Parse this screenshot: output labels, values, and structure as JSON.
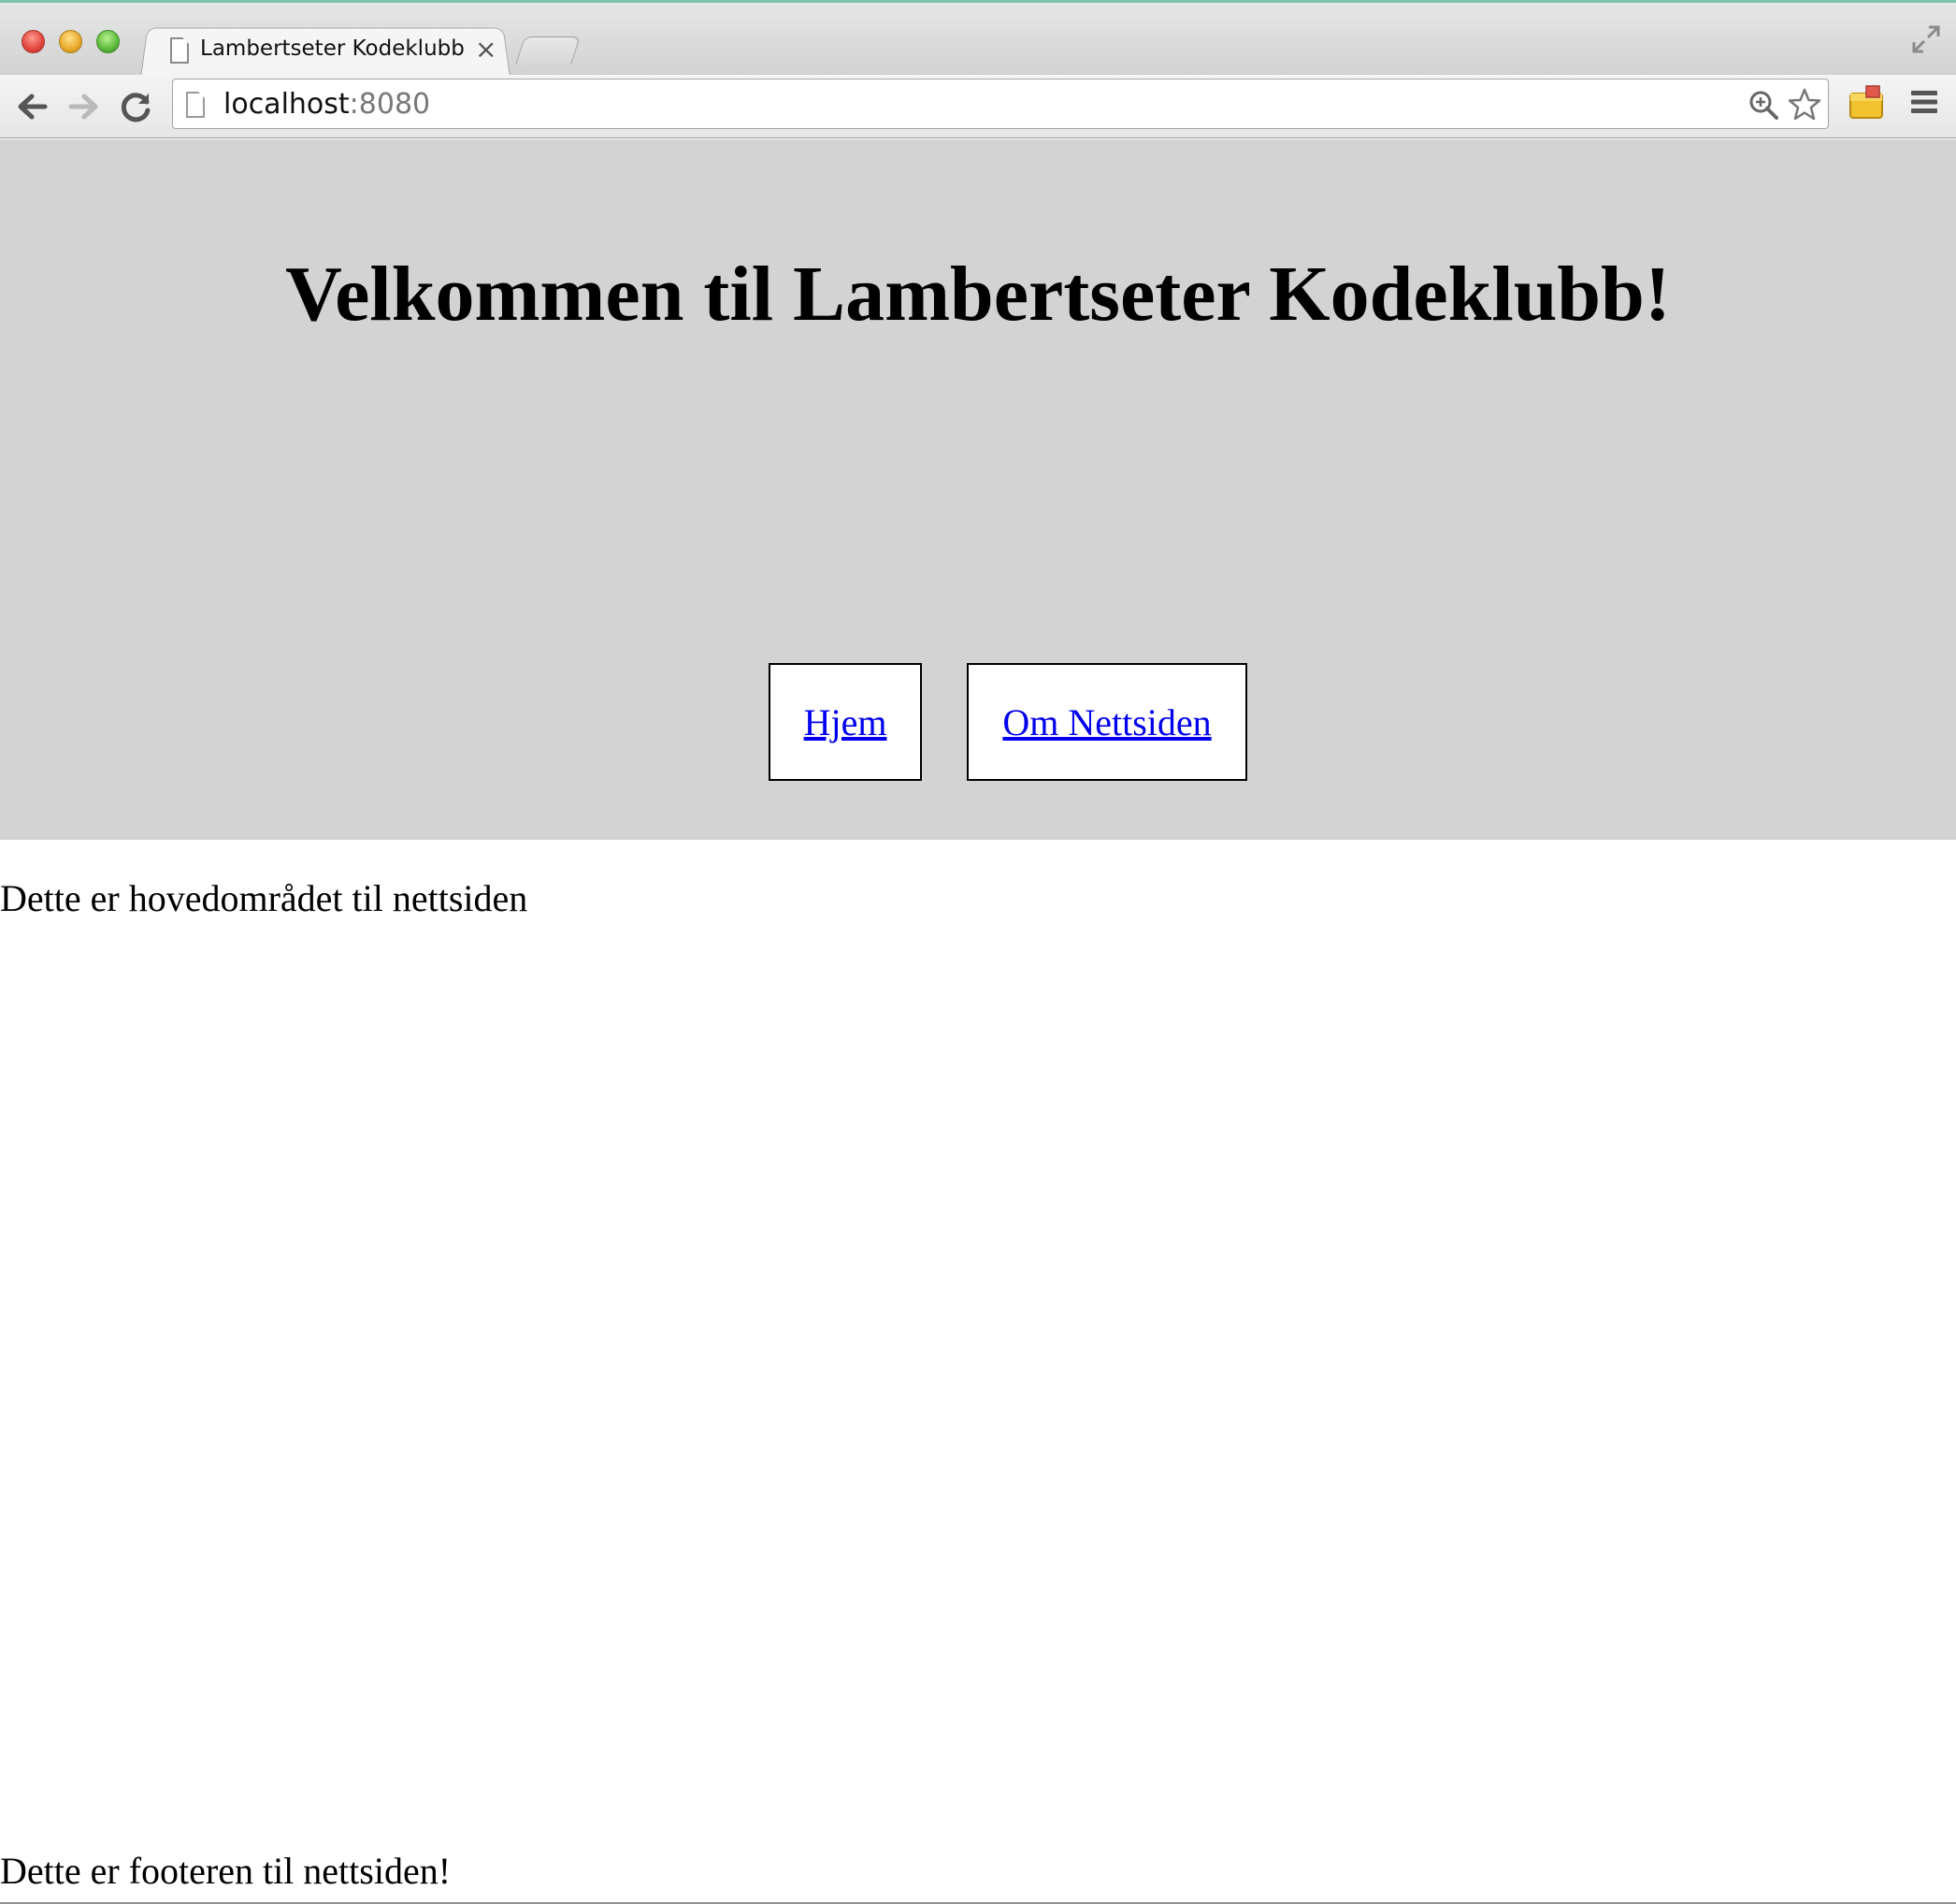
{
  "browser": {
    "tab": {
      "title": "Lambertseter Kodeklubb",
      "close_glyph": "×"
    },
    "address_bar": {
      "host": "localhost",
      "port": ":8080"
    },
    "icons": [
      "back-icon",
      "forward-icon",
      "reload-icon",
      "page-icon",
      "zoom-icon",
      "star-icon",
      "extension-icon",
      "menu-icon",
      "fullscreen-icon"
    ]
  },
  "page": {
    "header": {
      "title": "Velkommen til Lambertseter Kodeklubb!",
      "nav": [
        {
          "label": "Hjem"
        },
        {
          "label": "Om Nettsiden"
        }
      ]
    },
    "main": {
      "text": "Dette er hovedområdet til nettsiden"
    },
    "footer": {
      "text": "Dette er footeren til nettsiden!"
    }
  },
  "colors": {
    "header_background": "#d3d3d3",
    "link": "#0000ee",
    "nav_box_background": "#ffffff"
  }
}
